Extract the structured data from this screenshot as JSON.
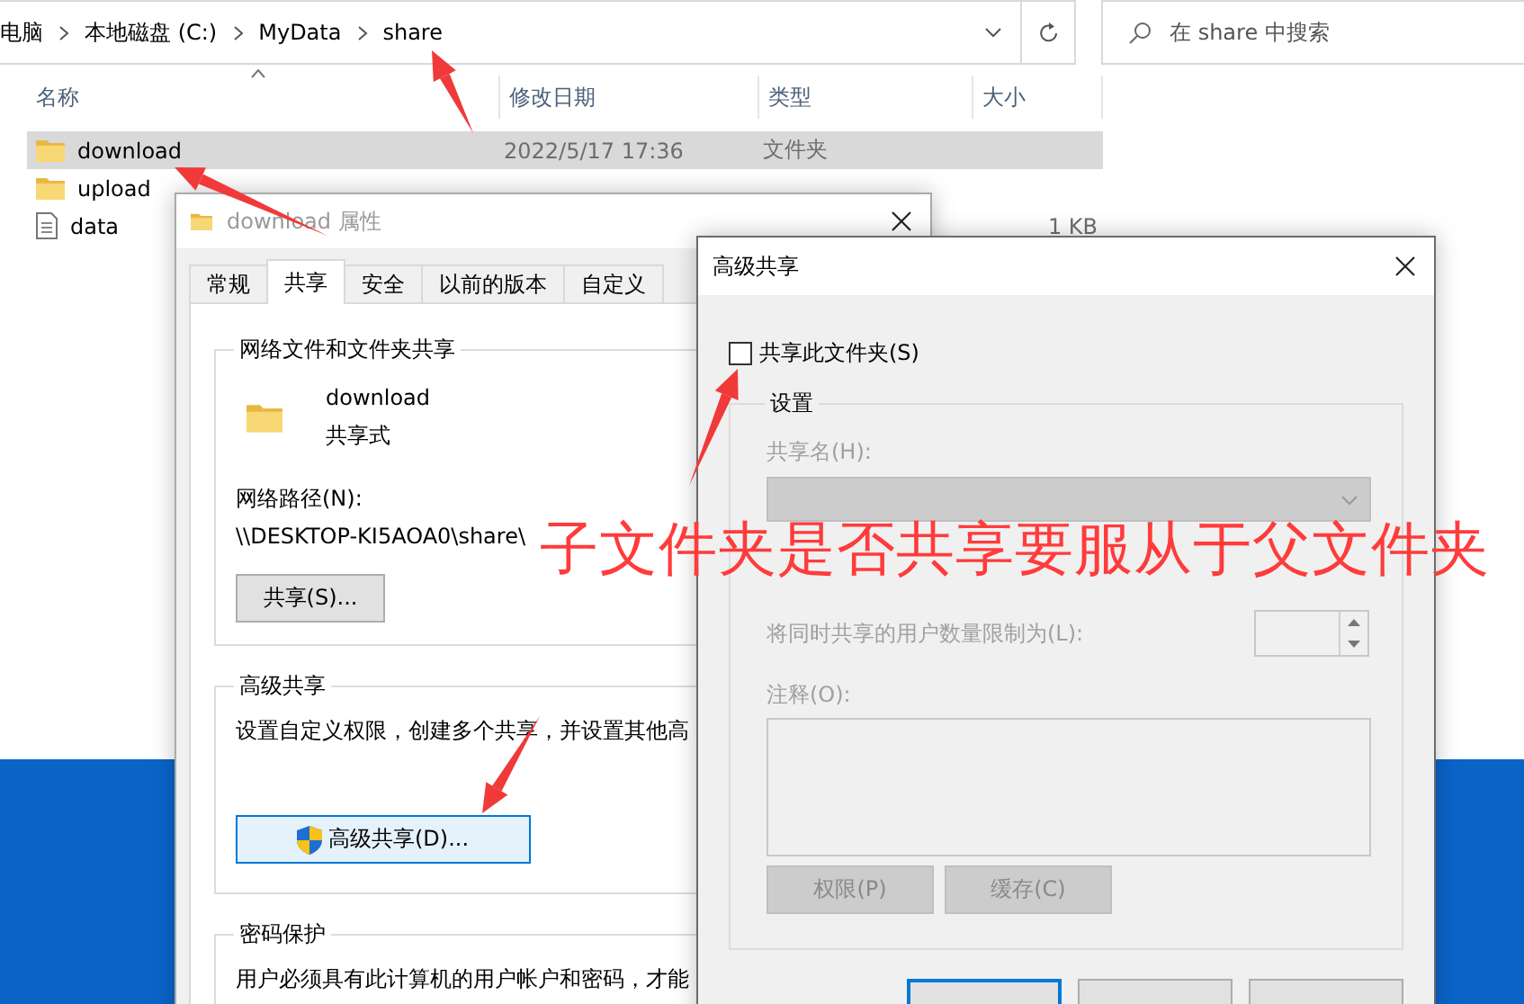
{
  "explorer": {
    "breadcrumb": [
      "电脑",
      "本地磁盘 (C:)",
      "MyData",
      "share"
    ],
    "search": {
      "placeholder": "在 share 中搜索"
    },
    "columns": [
      "名称",
      "修改日期",
      "类型",
      "大小"
    ],
    "rows": [
      {
        "kind": "folder",
        "name": "download",
        "date": "2022/5/17 17:36",
        "type": "文件夹",
        "selected": true
      },
      {
        "kind": "folder",
        "name": "upload",
        "selected": false
      },
      {
        "kind": "file",
        "name": "data",
        "size": "1 KB",
        "selected": false
      }
    ]
  },
  "properties": {
    "title": "download 属性",
    "tabs": [
      {
        "label": "常规",
        "selected": false
      },
      {
        "label": "共享",
        "selected": true
      },
      {
        "label": "安全",
        "selected": false
      },
      {
        "label": "以前的版本",
        "selected": false
      },
      {
        "label": "自定义",
        "selected": false
      }
    ],
    "sharing_group": {
      "title": "网络文件和文件夹共享",
      "folder_name": "download",
      "status": "共享式",
      "path_label": "网络路径(N):",
      "path": "\\\\DESKTOP-KI5AOA0\\share\\",
      "button": "共享(S)..."
    },
    "advanced_group": {
      "title": "高级共享",
      "description": "设置自定义权限，创建多个共享，并设置其他高",
      "button": "高级共享(D)..."
    },
    "password_group": {
      "title": "密码保护",
      "description": "用户必须具有此计算机的用户帐户和密码，才能"
    }
  },
  "advanced_dialog": {
    "title": "高级共享",
    "share_checkbox": {
      "label": "共享此文件夹(S)",
      "checked": false
    },
    "settings": {
      "title": "设置",
      "disabled": true,
      "share_name_label": "共享名(H):",
      "limit_label": "将同时共享的用户数量限制为(L):",
      "comment_label": "注释(O):",
      "permissions_button": "权限(P)",
      "caching_button": "缓存(C)"
    }
  },
  "annotation": {
    "text": "子文件夹是否共享要服从于父文件夹"
  }
}
